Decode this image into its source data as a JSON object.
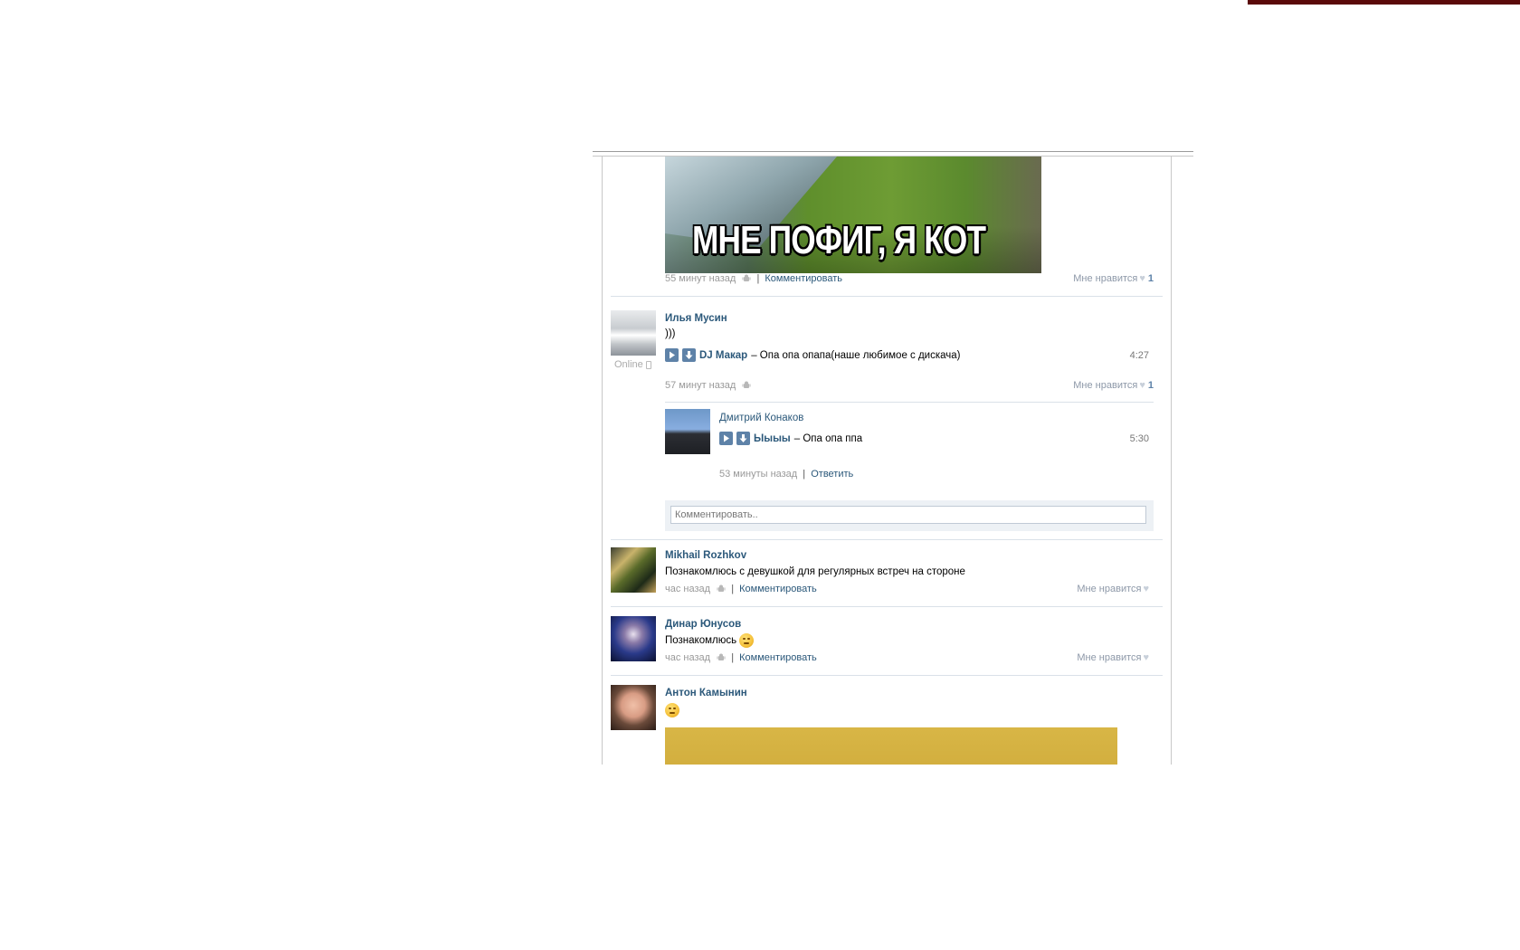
{
  "image_caption": "МНЕ ПОФИГ, Я КОТ",
  "first_post": {
    "time": "55 минут назад",
    "comment_label": "Комментировать",
    "like_label": "Мне нравится",
    "like_count": "1"
  },
  "post_ilya": {
    "author": "Илья Мусин",
    "status": "Online",
    "text": ")))",
    "audio": {
      "artist": "DJ Макар",
      "title": "– Опа опа опапа(наше любимое с дискача)",
      "duration": "4:27"
    },
    "time": "57 минут назад",
    "like_label": "Мне нравится",
    "like_count": "1",
    "reply": {
      "author": "Дмитрий Конаков",
      "audio": {
        "artist": "Ыыыы",
        "title": "– Опа опа ппа",
        "duration": "5:30"
      },
      "time": "53 минуты назад",
      "reply_label": "Ответить"
    },
    "comment_placeholder": "Комментировать.."
  },
  "post_mikhail": {
    "author": "Mikhail Rozhkov",
    "text": "Познакомлюсь с девушкой для регулярных встреч на стороне",
    "time": "час назад",
    "comment_label": "Комментировать",
    "like_label": "Мне нравится"
  },
  "post_dinar": {
    "author": "Динар Юнусов",
    "text": "Познакомлюсь",
    "time": "час назад",
    "comment_label": "Комментировать",
    "like_label": "Мне нравится"
  },
  "post_anton": {
    "author": "Антон Камынин"
  },
  "colors": {
    "link": "#2b587a",
    "meta": "#999999",
    "accent": "#5e82a8"
  }
}
